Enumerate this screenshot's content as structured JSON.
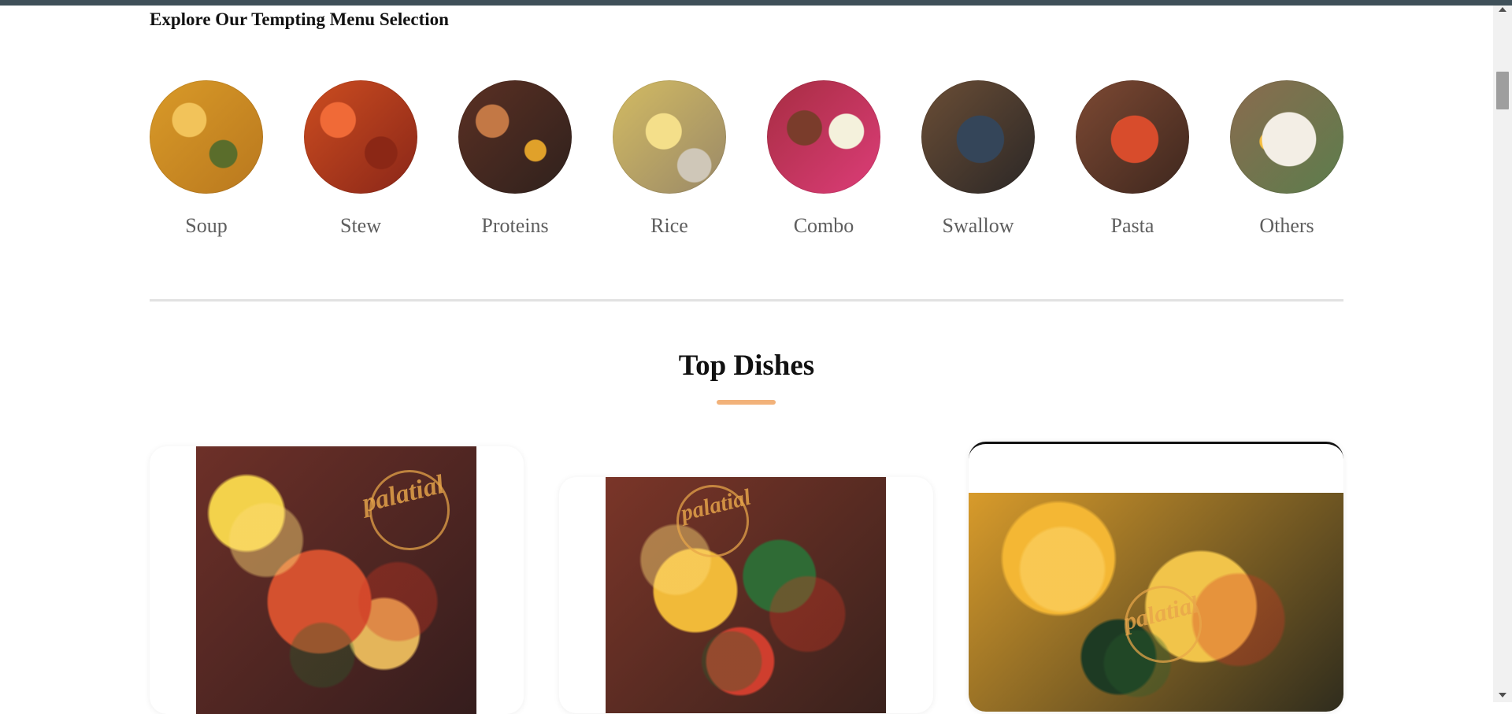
{
  "page": {
    "explore_title": "Explore Our Tempting Menu Selection",
    "top_dishes_title": "Top Dishes"
  },
  "categories": [
    {
      "label": "Soup",
      "icon": "soup-image",
      "color": "#d99a28"
    },
    {
      "label": "Stew",
      "icon": "stew-image",
      "color": "#cc4d20"
    },
    {
      "label": "Proteins",
      "icon": "proteins-image",
      "color": "#5b3023"
    },
    {
      "label": "Rice",
      "icon": "rice-image",
      "color": "#d3bb62"
    },
    {
      "label": "Combo",
      "icon": "combo-image",
      "color": "#a72d42"
    },
    {
      "label": "Swallow",
      "icon": "swallow-image",
      "color": "#6b4e36"
    },
    {
      "label": "Pasta",
      "icon": "pasta-image",
      "color": "#c9472a"
    },
    {
      "label": "Others",
      "icon": "others-image",
      "color": "#8a6b4e"
    }
  ],
  "top_dishes": [
    {
      "icon": "fish-pepper-soup-image",
      "brand_text": "palatial",
      "colors": [
        "#6d3028",
        "#d4a13a"
      ]
    },
    {
      "icon": "vegetable-fish-stew-image",
      "brand_text": "palatial",
      "colors": [
        "#7a3528",
        "#d29d36"
      ]
    },
    {
      "icon": "egusi-soup-image",
      "brand_text": "palatial",
      "colors": [
        "#d89b2b",
        "#2f2c1d"
      ]
    }
  ],
  "colors": {
    "accent": "#f2b27a",
    "top_bar": "#3f5059"
  }
}
